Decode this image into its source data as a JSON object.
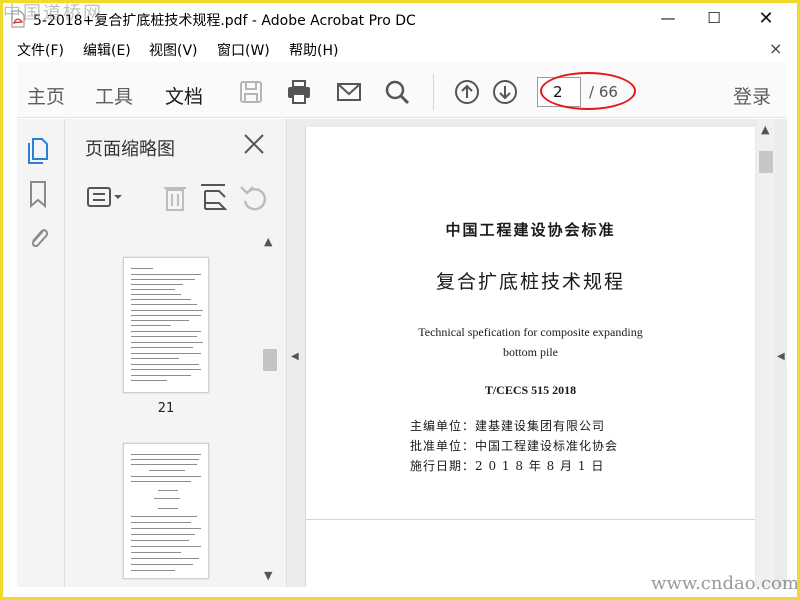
{
  "window": {
    "title": "5-2018+复合扩底桩技术规程.pdf - Adobe Acrobat Pro DC",
    "minimize_glyph": "—",
    "maximize_glyph": "☐",
    "close_glyph": "✕"
  },
  "menu": {
    "items": [
      "文件(F)",
      "编辑(E)",
      "视图(V)",
      "窗口(W)",
      "帮助(H)"
    ],
    "close_glyph": "×"
  },
  "toolbar": {
    "tabs": [
      {
        "label": "主页",
        "active": false
      },
      {
        "label": "工具",
        "active": false
      },
      {
        "label": "文档",
        "active": true
      }
    ],
    "icons": [
      "save-icon",
      "print-icon",
      "email-icon",
      "search-icon",
      "previous-page-icon",
      "next-page-icon"
    ],
    "page_current": "2",
    "page_total": "/ 66",
    "login_label": "登录",
    "highlight_color": "#e21717"
  },
  "left_rail": {
    "icons": [
      "page-thumbnails-icon",
      "bookmarks-icon",
      "attachments-icon"
    ]
  },
  "thumbnail_panel": {
    "title": "页面缩略图",
    "tools": [
      "options-menu-icon",
      "delete-icon",
      "extract-icon",
      "undo-icon"
    ],
    "thumbnails": [
      {
        "label": "21"
      },
      {
        "label": ""
      }
    ]
  },
  "document": {
    "standard_line": "中国工程建设协会标准",
    "title": "复合扩底桩技术规程",
    "english_title_line1": "Technical spefication for composite expanding",
    "english_title_line2": "bottom pile",
    "code": "T/CECS 515 2018",
    "editor_line": "主编单位：建基建设集团有限公司",
    "approver_line": "批准单位：中国工程建设标准化协会",
    "date_line": "施行日期：2 0 1 8 年 8 月 1 日"
  },
  "watermarks": {
    "top": "中国道桥网",
    "bottom": "www.cndao.com"
  },
  "colors": {
    "frame_border": "#f1da2e",
    "accent_red": "#e21717"
  }
}
